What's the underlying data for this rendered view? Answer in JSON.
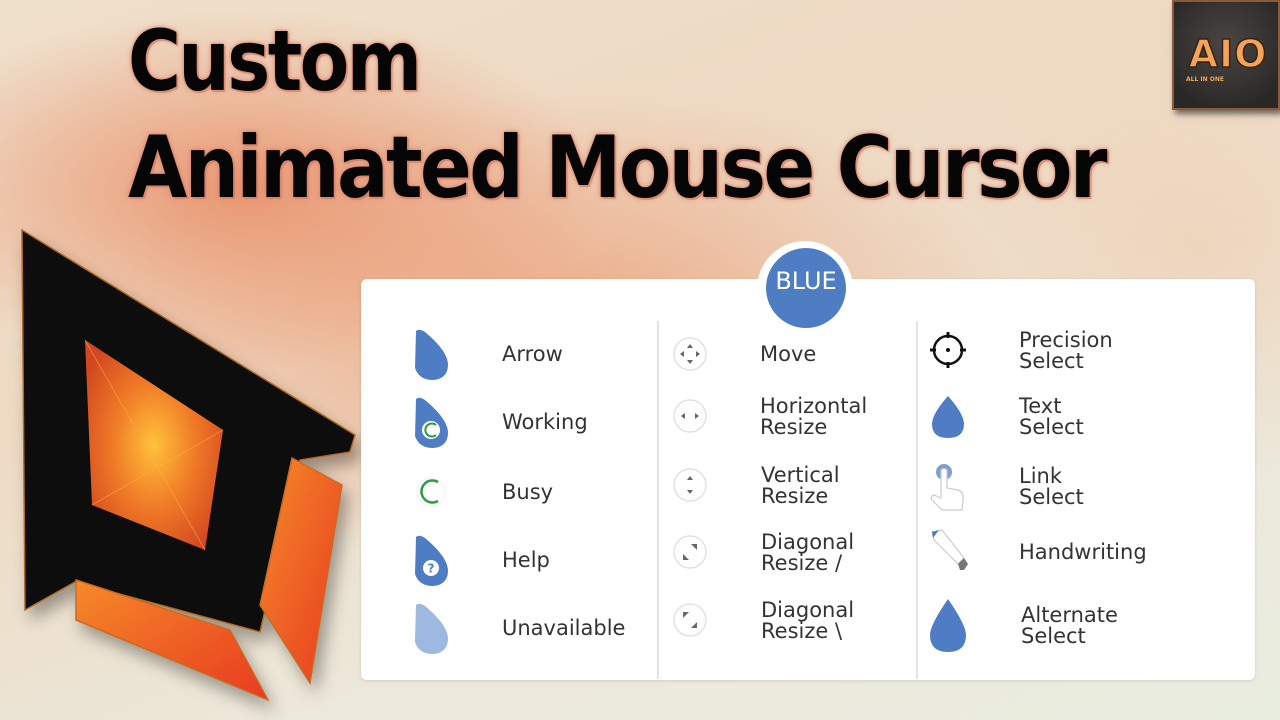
{
  "title": {
    "line1": "Custom",
    "line2": "Animated Mouse Cursor"
  },
  "brand_logo": {
    "text": "AIO",
    "subtitle": "ALL IN ONE"
  },
  "theme": {
    "badge_label": "BLUE",
    "accent_color": "#4f7dc4",
    "light_accent_color": "#9db9e2",
    "spinner_color": "#2e9b45"
  },
  "cursors": {
    "column1": [
      {
        "name": "Arrow",
        "icon": "drop-arrow-icon"
      },
      {
        "name": "Working",
        "icon": "drop-working-icon"
      },
      {
        "name": "Busy",
        "icon": "spinner-icon"
      },
      {
        "name": "Help",
        "icon": "drop-help-icon"
      },
      {
        "name": "Unavailable",
        "icon": "drop-unavailable-icon"
      }
    ],
    "column2": [
      {
        "line1": "Move",
        "line2": "",
        "icon": "move-arrows-icon"
      },
      {
        "line1": "Horizontal",
        "line2": "Resize",
        "icon": "horizontal-resize-icon"
      },
      {
        "line1": "Vertical",
        "line2": "Resize",
        "icon": "vertical-resize-icon"
      },
      {
        "line1": "Diagonal",
        "line2": "Resize /",
        "icon": "diagonal-resize-1-icon"
      },
      {
        "line1": "Diagonal",
        "line2": "Resize \\",
        "icon": "diagonal-resize-2-icon"
      }
    ],
    "column3": [
      {
        "line1": "Precision",
        "line2": "Select",
        "icon": "crosshair-icon"
      },
      {
        "line1": "Text",
        "line2": "Select",
        "icon": "drop-text-icon"
      },
      {
        "line1": "Link",
        "line2": "Select",
        "icon": "hand-pointer-icon"
      },
      {
        "line1": "Handwriting",
        "line2": "",
        "icon": "pen-icon"
      },
      {
        "line1": "Alternate",
        "line2": "Select",
        "icon": "drop-alternate-icon"
      }
    ]
  }
}
